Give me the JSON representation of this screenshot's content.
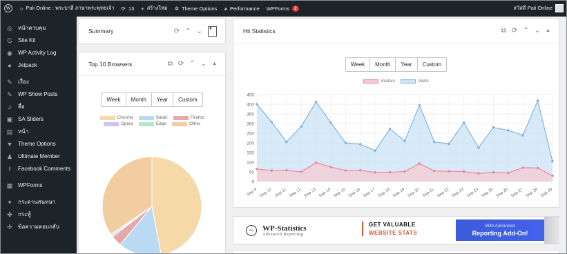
{
  "adminbar": {
    "site_name": "Pali Online : พระบาลี ภาษาพระพุทธเจ้า",
    "updates_count": "13",
    "new_label": "สร้างใหม่",
    "theme_options": "Theme Options",
    "performance": "Performance",
    "wpforms": "WPForms",
    "wpforms_badge": "2",
    "user_greeting": "สวัสดี Pali Online"
  },
  "sidebar": {
    "items": [
      {
        "label": "หน้าควบคุม",
        "icon": "gauge-icon",
        "glyph": "◎"
      },
      {
        "label": "Site Kit",
        "icon": "google-g-icon",
        "glyph": "G"
      },
      {
        "label": "WP Activity Log",
        "icon": "activity-log-icon",
        "glyph": "◉"
      },
      {
        "label": "Jetpack",
        "icon": "jetpack-icon",
        "glyph": "●"
      },
      {
        "label": "เรื่อง",
        "icon": "pin-icon",
        "glyph": "✎"
      },
      {
        "label": "WP Show Posts",
        "icon": "pin-icon",
        "glyph": "✎"
      },
      {
        "label": "สื่อ",
        "icon": "media-icon",
        "glyph": "♫"
      },
      {
        "label": "SA Sliders",
        "icon": "slider-icon",
        "glyph": "▣"
      },
      {
        "label": "หน้า",
        "icon": "page-icon",
        "glyph": "▤"
      },
      {
        "label": "Theme Options",
        "icon": "triangle-down-icon",
        "glyph": "▼"
      },
      {
        "label": "Ultimate Member",
        "icon": "user-icon",
        "glyph": "♟"
      },
      {
        "label": "Facebook Comments",
        "icon": "facebook-icon",
        "glyph": "f"
      },
      {
        "label": "WPForms",
        "icon": "forms-icon",
        "glyph": "▦"
      },
      {
        "label": "กระดานสนทนา",
        "icon": "forum-icon",
        "glyph": "✦"
      },
      {
        "label": "กระทู้",
        "icon": "topics-icon",
        "glyph": "✤"
      },
      {
        "label": "ข้อความตอบกลับ",
        "icon": "replies-icon",
        "glyph": "✣"
      }
    ]
  },
  "summary": {
    "title": "Summary"
  },
  "browsers": {
    "title": "Top 10 Browsers",
    "tabs": [
      "Week",
      "Month",
      "Year",
      "Custom"
    ]
  },
  "hits": {
    "title": "Hit Statistics",
    "tabs": [
      "Week",
      "Month",
      "Year",
      "Custom"
    ]
  },
  "banner": {
    "brand": "WP-Statistics",
    "brand_sub": "Advanced Reporting",
    "line1": "GET VALUABLE",
    "line2": "WEBSITE STATS",
    "cta_top": "With Advanced",
    "cta_main": "Reporting Add-On!"
  },
  "chart_data": [
    {
      "type": "pie",
      "title": "Top 10 Browsers",
      "categories": [
        "Chrome",
        "Safari",
        "Firefox",
        "Opera",
        "Edge",
        "Other"
      ],
      "values": [
        47,
        14,
        3.5,
        0.5,
        0.5,
        34.5
      ],
      "colors": [
        "#f5d9a8",
        "#b9daf2",
        "#e4aaaa",
        "#d6c3ea",
        "#b7e6cf",
        "#f2cda2"
      ],
      "legend": "top"
    },
    {
      "type": "area",
      "title": "Hit Statistics",
      "x": [
        "Sep 9",
        "Sep 10",
        "Sep 11",
        "Sep 12",
        "Sep 13",
        "Sep 14",
        "Sep 15",
        "Sep 16",
        "Sep 17",
        "Sep 18",
        "Sep 19",
        "Sep 20",
        "Sep 21",
        "Sep 22",
        "Sep 23",
        "Sep 24",
        "Sep 25",
        "Sep 26",
        "Sep 27",
        "Sep 28",
        "Sep 29"
      ],
      "series": [
        {
          "name": "Visitors",
          "values": [
            65,
            57,
            58,
            50,
            98,
            75,
            57,
            58,
            47,
            48,
            52,
            93,
            55,
            53,
            52,
            42,
            47,
            45,
            72,
            70,
            30
          ],
          "color": "#e98b9b",
          "fill": "#f5c9d3"
        },
        {
          "name": "Visits",
          "values": [
            400,
            308,
            205,
            285,
            412,
            305,
            200,
            193,
            160,
            272,
            210,
            395,
            205,
            195,
            305,
            175,
            280,
            265,
            240,
            418,
            105
          ],
          "color": "#7fb6e3",
          "fill": "#cbe3f6"
        }
      ],
      "ylim": [
        0,
        450
      ],
      "yticks": [
        0,
        50,
        100,
        150,
        200,
        250,
        300,
        350,
        400,
        450
      ],
      "legend": "top",
      "grid": true
    }
  ]
}
